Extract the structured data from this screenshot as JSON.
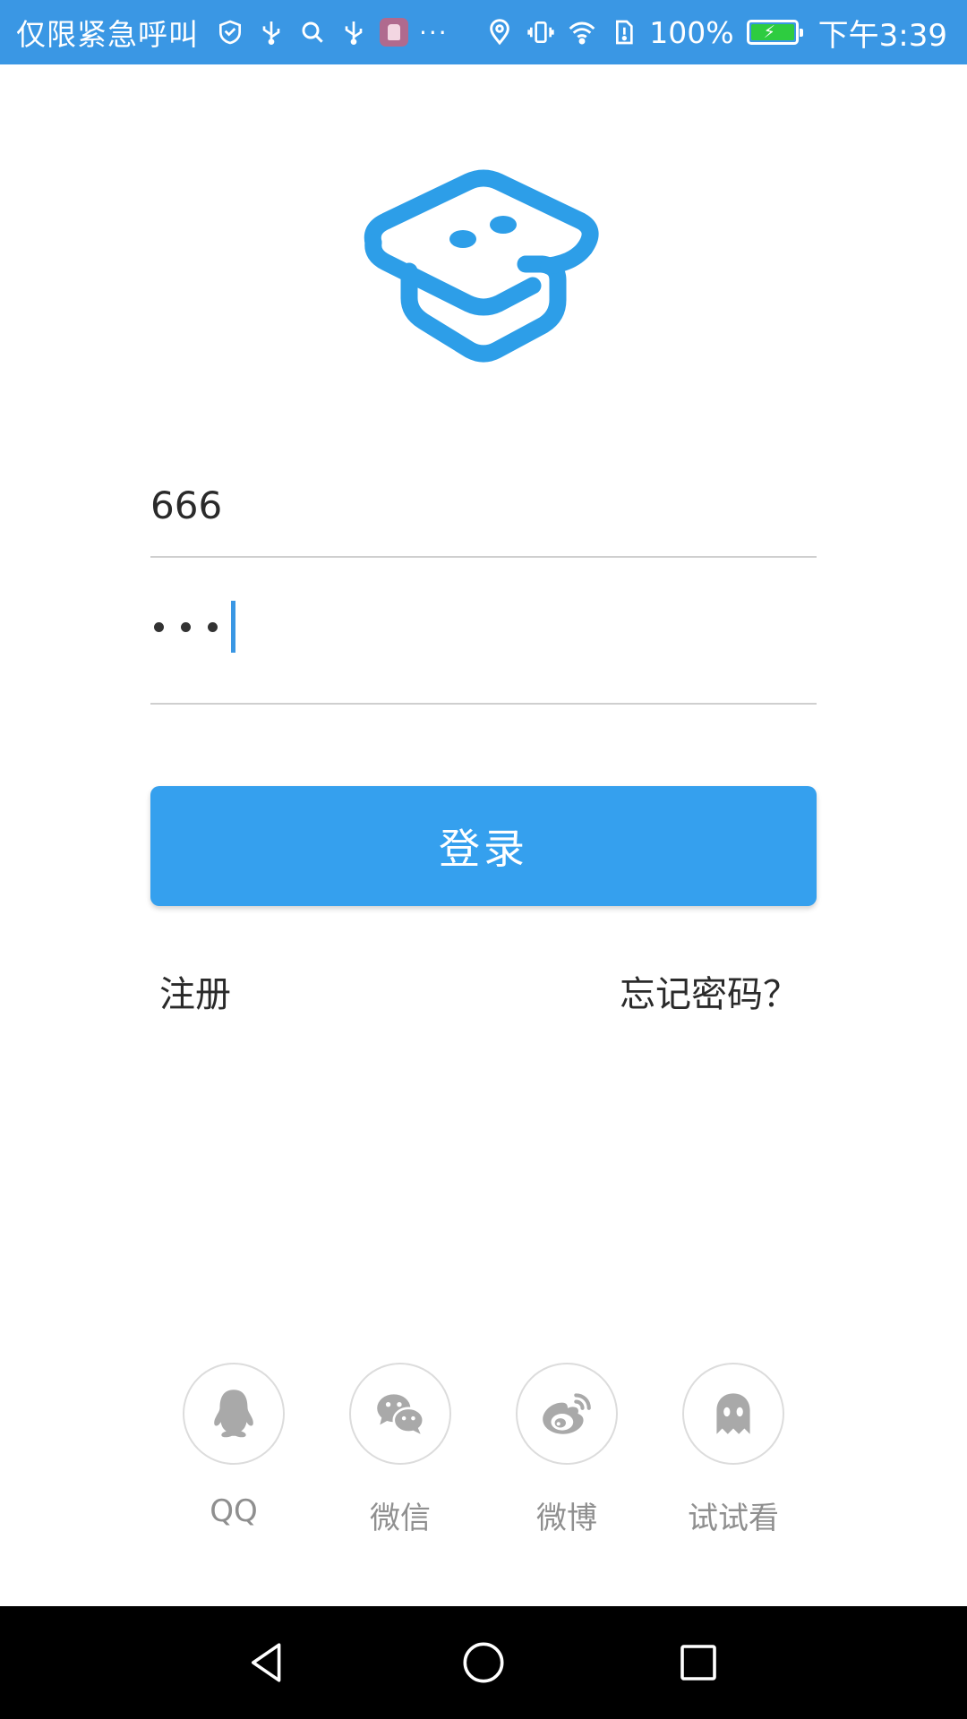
{
  "status_bar": {
    "carrier": "仅限紧急呼叫",
    "left_icons": [
      "shield-check-icon",
      "usb-icon",
      "search-icon",
      "usb-icon",
      "app-badge-icon",
      "more-dots-icon"
    ],
    "more": "···",
    "right_icons": [
      "location-icon",
      "vibrate-icon",
      "wifi-icon",
      "sim-alert-icon",
      "battery-icon"
    ],
    "battery_percent": "100%",
    "battery_level": 1.0,
    "battery_color": "#2ecc40",
    "time": "下午3:39",
    "background": "#3a97e4"
  },
  "logo": {
    "icon": "graduation-cap-logo-icon",
    "color": "#2d9ee8"
  },
  "login_form": {
    "username": {
      "value": "666"
    },
    "password": {
      "masked_length": 3,
      "focused": true
    }
  },
  "login_button": {
    "label": "登录",
    "color": "#35a0ee"
  },
  "links": {
    "register": "注册",
    "forgot_password": "忘记密码？"
  },
  "social_login": [
    {
      "id": "qq",
      "label": "QQ",
      "icon": "qq-penguin-icon"
    },
    {
      "id": "wechat",
      "label": "微信",
      "icon": "wechat-icon"
    },
    {
      "id": "weibo",
      "label": "微博",
      "icon": "weibo-icon"
    },
    {
      "id": "trial",
      "label": "试试看",
      "icon": "ghost-icon"
    }
  ],
  "nav_bar": {
    "icons": [
      "back-triangle-icon",
      "home-circle-icon",
      "recents-square-icon"
    ]
  }
}
